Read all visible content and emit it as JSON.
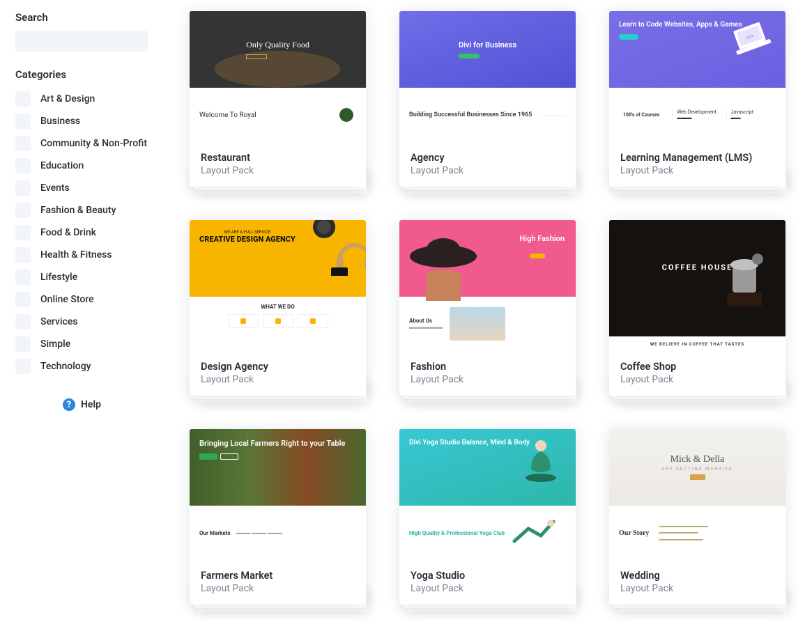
{
  "sidebar": {
    "search_label": "Search",
    "categories_label": "Categories",
    "categories": [
      "Art & Design",
      "Business",
      "Community & Non-Profit",
      "Education",
      "Events",
      "Fashion & Beauty",
      "Food & Drink",
      "Health & Fitness",
      "Lifestyle",
      "Online Store",
      "Services",
      "Simple",
      "Technology"
    ],
    "help_label": "Help"
  },
  "subtitle": "Layout Pack",
  "cards": [
    {
      "title": "Restaurant",
      "preview": {
        "headline": "Only Quality Food",
        "section": "Welcome To Royal"
      }
    },
    {
      "title": "Agency",
      "preview": {
        "headline": "Divi for Business",
        "section": "Building Successful Businesses Since 1965"
      }
    },
    {
      "title": "Learning Management (LMS)",
      "preview": {
        "headline": "Learn to Code Websites, Apps & Games",
        "section": "100's of Courses"
      }
    },
    {
      "title": "Design Agency",
      "preview": {
        "headline": "CREATIVE DESIGN AGENCY",
        "section": "WHAT WE DO"
      }
    },
    {
      "title": "Fashion",
      "preview": {
        "headline": "High Fashion",
        "section": "About Us"
      }
    },
    {
      "title": "Coffee Shop",
      "preview": {
        "headline": "COFFEE HOUSE",
        "section": "WE BELIEVE IN COFFEE THAT TASTES"
      }
    },
    {
      "title": "Farmers Market",
      "preview": {
        "headline": "Bringing Local Farmers Right to your Table",
        "section": "Our Markets"
      }
    },
    {
      "title": "Yoga Studio",
      "preview": {
        "headline": "Divi Yoga Studio Balance, Mind & Body",
        "section": "High Quality & Professional Yoga Club"
      }
    },
    {
      "title": "Wedding",
      "preview": {
        "headline": "Mick & Della",
        "sub": "ARE GETTING MARRIED",
        "section": "Our Story"
      }
    }
  ]
}
